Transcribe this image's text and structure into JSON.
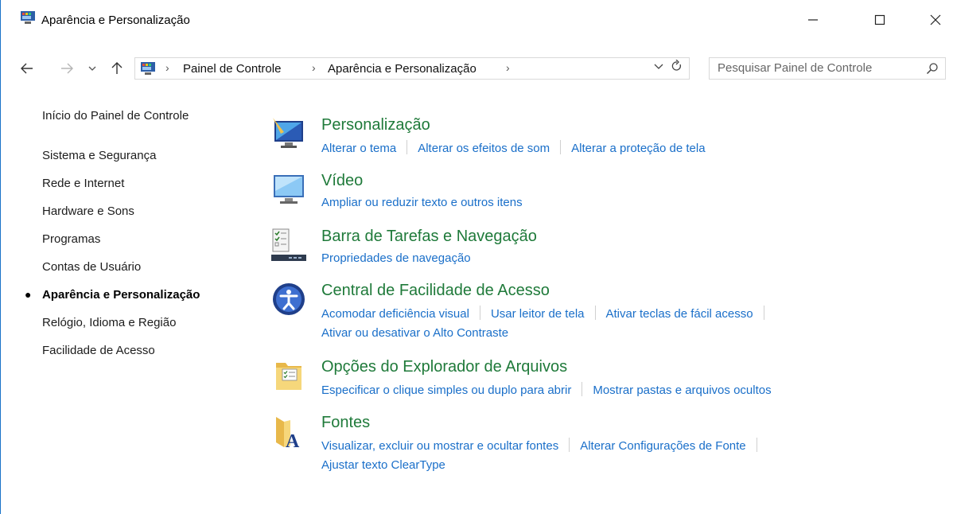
{
  "window": {
    "title": "Aparência e Personalização",
    "icon": "control-panel-icon",
    "controls": {
      "minimize": "minimize-icon",
      "maximize": "maximize-icon",
      "close": "close-icon"
    }
  },
  "nav": {
    "back": "back-arrow-icon",
    "forward": "forward-arrow-icon",
    "recent": "chevron-down-icon",
    "up": "up-arrow-icon",
    "breadcrumbs": [
      "Painel de Controle",
      "Aparência e Personalização"
    ],
    "refresh": "refresh-icon"
  },
  "search": {
    "placeholder": "Pesquisar Painel de Controle"
  },
  "sidebar": {
    "home": "Início do Painel de Controle",
    "items": [
      {
        "label": "Sistema e Segurança",
        "current": false
      },
      {
        "label": "Rede e Internet",
        "current": false
      },
      {
        "label": "Hardware e Sons",
        "current": false
      },
      {
        "label": "Programas",
        "current": false
      },
      {
        "label": "Contas de Usuário",
        "current": false
      },
      {
        "label": "Aparência e Personalização",
        "current": true
      },
      {
        "label": "Relógio, Idioma e Região",
        "current": false
      },
      {
        "label": "Facilidade de Acesso",
        "current": false
      }
    ]
  },
  "categories": [
    {
      "title": "Personalização",
      "icon": "personalization-icon",
      "rows": [
        [
          "Alterar o tema",
          "Alterar os efeitos de som",
          "Alterar a proteção de tela"
        ]
      ]
    },
    {
      "title": "Vídeo",
      "icon": "monitor-icon",
      "rows": [
        [
          "Ampliar ou reduzir texto e outros itens"
        ]
      ]
    },
    {
      "title": "Barra de Tarefas e Navegação",
      "icon": "taskbar-icon",
      "rows": [
        [
          "Propriedades de navegação"
        ]
      ]
    },
    {
      "title": "Central de Facilidade de Acesso",
      "icon": "ease-of-access-icon",
      "rows": [
        [
          "Acomodar deficiência visual",
          "Usar leitor de tela",
          "Ativar teclas de fácil acesso"
        ],
        [
          "Ativar ou desativar o Alto Contraste"
        ]
      ]
    },
    {
      "title": "Opções do Explorador de Arquivos",
      "icon": "folder-options-icon",
      "rows": [
        [
          "Especificar o clique simples ou duplo para abrir",
          "Mostrar pastas e arquivos ocultos"
        ]
      ]
    },
    {
      "title": "Fontes",
      "icon": "fonts-folder-icon",
      "rows": [
        [
          "Visualizar, excluir ou mostrar e ocultar fontes",
          "Alterar Configurações de Fonte"
        ],
        [
          "Ajustar texto ClearType"
        ]
      ]
    }
  ],
  "colors": {
    "link": "#1a6fc9",
    "category_title": "#1f7a3a",
    "window_border": "#1a73c9"
  }
}
